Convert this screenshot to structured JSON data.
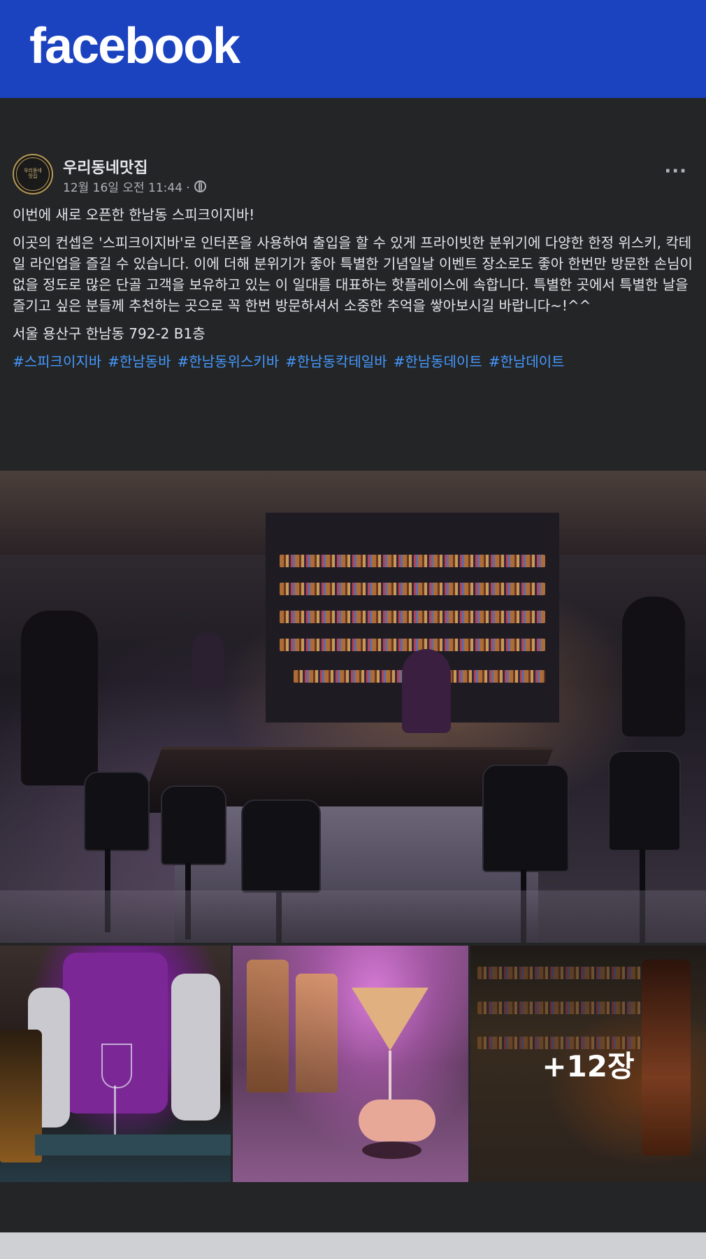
{
  "app": {
    "logo_text": "facebook"
  },
  "post": {
    "page_name": "우리동네맛집",
    "avatar_text_line1": "우리동네",
    "avatar_text_line2": "맛집",
    "timestamp": "12월 16일 오전 11:44 ·",
    "audience_icon": "globe-icon",
    "more_icon": "more-options-icon",
    "more_label": "···",
    "paragraph_1": "이번에 새로 오픈한 한남동 스피크이지바!",
    "paragraph_2": "이곳의 컨셉은 '스피크이지바'로 인터폰을 사용하여 출입을 할 수 있게 프라이빗한 분위기에 다양한 한정 위스키, 칵테일 라인업을 즐길 수 있습니다. 이에 더해 분위기가 좋아 특별한 기념일날 이벤트 장소로도 좋아 한번만 방문한 손님이 없을 정도로 많은 단골 고객을 보유하고 있는 이 일대를 대표하는 핫플레이스에 속합니다. 특별한 곳에서 특별한 날을 즐기고 싶은 분들께 추천하는 곳으로 꼭 한번 방문하셔서 소중한 추억을 쌓아보시길 바랍니다~!^^",
    "address": "서울 용산구 한남동 792-2 B1층",
    "hashtags": [
      "#스피크이지바",
      "#한남동바",
      "#한남동위스키바",
      "#한남동칵테일바",
      "#한남동데이트",
      "#한남데이트"
    ]
  },
  "photos": {
    "more_count_label": "+12장"
  },
  "colors": {
    "topbar": "#1b43c0",
    "background": "#242526",
    "text": "#e4e6eb",
    "secondary_text": "#b0b3b8",
    "hashtag": "#4599ff"
  }
}
